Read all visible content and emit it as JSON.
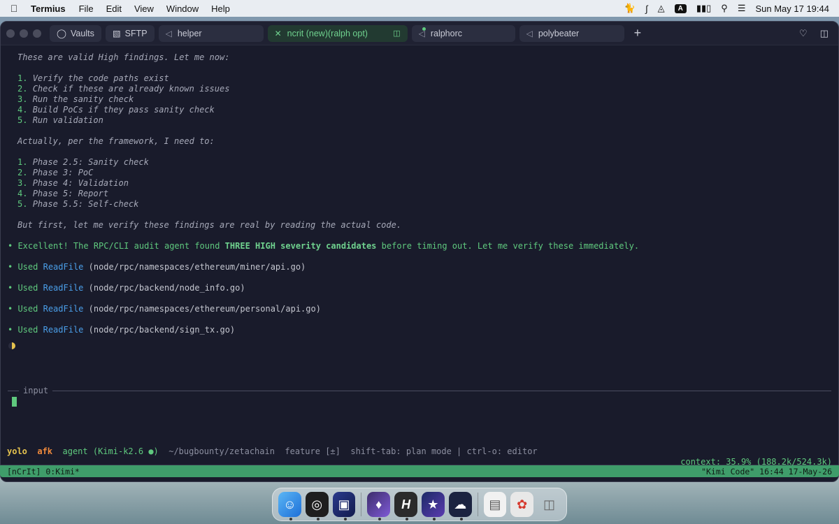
{
  "menubar": {
    "app_name": "Termius",
    "menus": [
      "File",
      "Edit",
      "View",
      "Window",
      "Help"
    ],
    "input_source": "A",
    "clock": "Sun May 17  19:44"
  },
  "window": {
    "vaults_label": "Vaults",
    "sftp_label": "SFTP",
    "tabs": [
      {
        "label": "helper",
        "active": false
      },
      {
        "label": "ncrit (new)(ralph opt)",
        "active": true
      },
      {
        "label": "ralphorc",
        "active": false
      },
      {
        "label": "polybeater",
        "active": false
      }
    ]
  },
  "terminal": {
    "intro": "These are valid High findings. Let me now:",
    "steps_a": [
      "Verify the code paths exist",
      "Check if these are already known issues",
      "Run the sanity check",
      "Build PoCs if they pass sanity check",
      "Run validation"
    ],
    "framework_intro": "Actually, per the framework, I need to:",
    "steps_b": [
      "Phase 2.5: Sanity check",
      "Phase 3: PoC",
      "Phase 4: Validation",
      "Phase 5: Report",
      "Phase 5.5: Self-check"
    ],
    "verify_note": "But first, let me verify these findings are real by reading the actual code.",
    "agent_msg_pre": "Excellent! The RPC/CLI audit agent found ",
    "agent_msg_bold": "THREE HIGH severity candidates",
    "agent_msg_post": " before timing out. Let me verify these immediately.",
    "used_label": "Used",
    "tool_name": "ReadFile",
    "tool_calls": [
      "(node/rpc/namespaces/ethereum/miner/api.go)",
      "(node/rpc/backend/node_info.go)",
      "(node/rpc/namespaces/ethereum/personal/api.go)",
      "(node/rpc/backend/sign_tx.go)"
    ],
    "input_label": "input"
  },
  "statusline": {
    "yolo": "yolo",
    "afk": "afk",
    "agent": "agent (Kimi-k2.6 ●)",
    "path": "~/bugbounty/zetachain",
    "branch": "feature [±]",
    "hints": "shift-tab: plan mode | ctrl-o: editor",
    "context": "context: 35.9% (188.2k/524.3k)"
  },
  "tmux": {
    "left": "[nCrIt] 0:Kimi*",
    "right": "\"Kimi Code\" 16:44 17-May-26"
  },
  "colors": {
    "accent_green": "#5fc97e",
    "link_blue": "#4a9ee8",
    "tmux_green": "#3f9d6a",
    "background": "#191b2b"
  }
}
